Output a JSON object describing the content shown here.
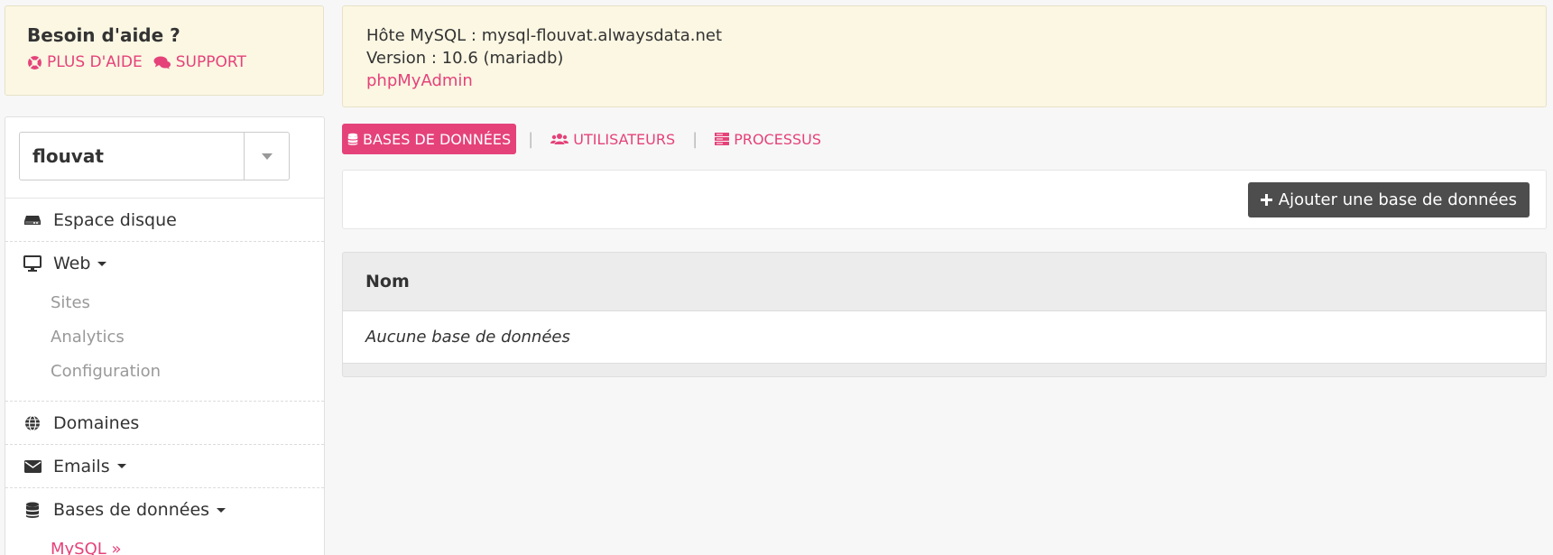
{
  "help": {
    "title": "Besoin d'aide ?",
    "more_help": "PLUS D'AIDE",
    "support": "SUPPORT"
  },
  "account": {
    "selected": "flouvat"
  },
  "sidebar": {
    "disk": "Espace disque",
    "web": "Web",
    "web_sub": [
      "Sites",
      "Analytics",
      "Configuration"
    ],
    "domains": "Domaines",
    "emails": "Emails",
    "databases": "Bases de données",
    "databases_sub": [
      "MySQL »"
    ]
  },
  "info": {
    "host": "Hôte MySQL : mysql-flouvat.alwaysdata.net",
    "version": "Version : 10.6 (mariadb)",
    "phpmyadmin": "phpMyAdmin"
  },
  "tabs": {
    "databases": "BASES DE DONNÉES",
    "users": "UTILISATEURS",
    "processes": "PROCESSUS",
    "separator": "|"
  },
  "toolbar": {
    "add_label": "Ajouter une base de données"
  },
  "table": {
    "header": "Nom",
    "empty": "Aucune base de données"
  },
  "colors": {
    "accent": "#e5427a",
    "info_bg": "#fbf7e3",
    "button_dark": "#4d4d4d"
  }
}
